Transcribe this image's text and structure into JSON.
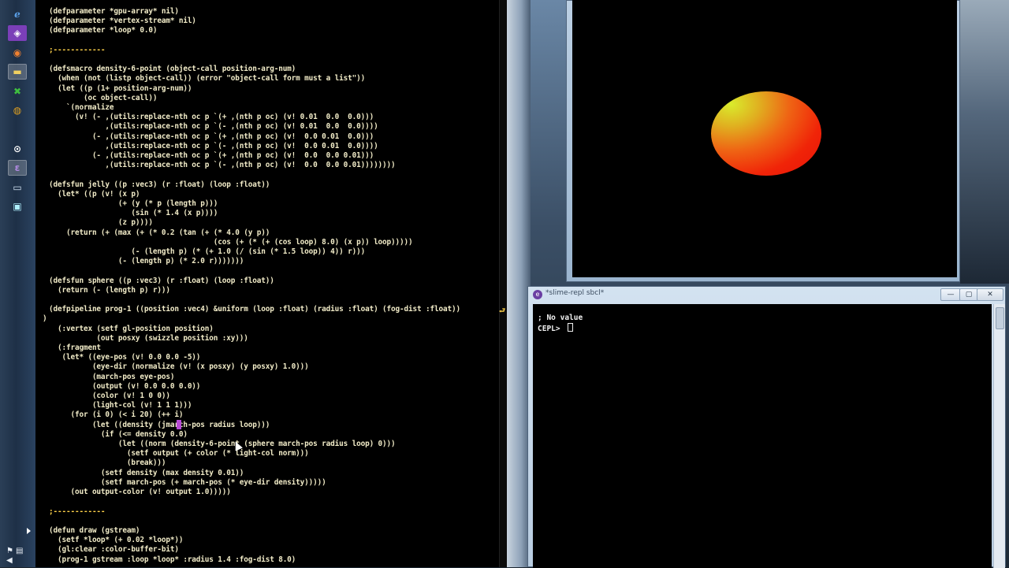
{
  "taskbar": {
    "icons": [
      "ie-icon",
      "visual-studio-icon",
      "firefox-icon",
      "folder-icon",
      "excel-icon",
      "chrome-icon",
      "obs-icon",
      "emacs-icon",
      "window-icon",
      "console-icon"
    ],
    "tray": {
      "flag": "⚑",
      "speaker": "◀",
      "network": "▤"
    }
  },
  "editor": {
    "lines": [
      "(defparameter *gpu-array* nil)",
      "(defparameter *vertex-stream* nil)",
      "(defparameter *loop* 0.0)",
      "",
      ";------------",
      "",
      "(defsmacro density-6-point (object-call position-arg-num)",
      "  (when (not (listp object-call)) (error \"object-call form must a list\"))",
      "  (let ((p (1+ position-arg-num))",
      "        (oc object-call))",
      "    `(normalize",
      "      (v! (- ,(utils:replace-nth oc p `(+ ,(nth p oc) (v! 0.01  0.0  0.0)))",
      "             ,(utils:replace-nth oc p `(- ,(nth p oc) (v! 0.01  0.0  0.0))))",
      "          (- ,(utils:replace-nth oc p `(+ ,(nth p oc) (v!  0.0 0.01  0.0)))",
      "             ,(utils:replace-nth oc p `(- ,(nth p oc) (v!  0.0 0.01  0.0))))",
      "          (- ,(utils:replace-nth oc p `(+ ,(nth p oc) (v!  0.0  0.0 0.01)))",
      "             ,(utils:replace-nth oc p `(- ,(nth p oc) (v!  0.0  0.0 0.01))))))))",
      "",
      "(defsfun jelly ((p :vec3) (r :float) (loop :float))",
      "  (let* ((p (v! (x p)",
      "                (+ (y (* p (length p)))",
      "                   (sin (* 1.4 (x p))))",
      "                (z p))))",
      "    (return (+ (max (+ (* 0.2 (tan (+ (* 4.0 (y p))",
      "                                      (cos (+ (* (+ (cos loop) 8.0) (x p)) loop)))))",
      "                   (- (length p) (* (+ 1.0 (/ (sin (* 1.5 loop)) 4)) r)))",
      "                (- (length p) (* 2.0 r)))))))",
      "",
      "(defsfun sphere ((p :vec3) (r :float) (loop :float))",
      "  (return (- (length p) r)))",
      "",
      "(defpipeline prog-1 ((position :vec4) &uniform (loop :float) (radius :float) (fog-dist :float))",
      ")",
      "  (:vertex (setf gl-position position)",
      "           (out posxy (swizzle position :xy)))",
      "  (:fragment",
      "   (let* ((eye-pos (v! 0.0 0.0 -5))",
      "          (eye-dir (normalize (v! (x posxy) (y posxy) 1.0)))",
      "          (march-pos eye-pos)",
      "          (output (v! 0.0 0.0 0.0))",
      "          (color (v! 1 0 0))",
      "          (light-col (v! 1 1 1)))",
      "     (for (i 0) (< i 20) (++ i)",
      "          (let ((density (jmarch-pos radius loop)))",
      "            (if (<= density 0.0)",
      "                (let ((norm (density-6-point (sphere march-pos radius loop) 0)))",
      "                  (setf output (+ color (* light-col norm)))",
      "                  (break)))",
      "            (setf density (max density 0.01))",
      "            (setf march-pos (+ march-pos (* eye-dir density)))))",
      "     (out output-color (v! output 1.0)))))",
      "",
      ";------------",
      "",
      "(defun draw (gstream)",
      "  (setf *loop* (+ 0.02 *loop*))",
      "  (gl:clear :color-buffer-bit)",
      "  (prog-1 gstream :loop *loop* :radius 1.4 :fog-dist 8.0)"
    ],
    "continuation_mark": "⮐",
    "wrap_mark": "$"
  },
  "repl": {
    "title": "*slime-repl sbcl*",
    "minimize": "—",
    "maximize": "▢",
    "close": "✕",
    "lines": [
      "; No value",
      "CEPL> "
    ]
  },
  "colors": {
    "code": "#f2ecc8",
    "comment": "#ffd24a",
    "background": "#000000",
    "blob_red": "#f02408",
    "blob_yellow": "#d9ec2c"
  }
}
